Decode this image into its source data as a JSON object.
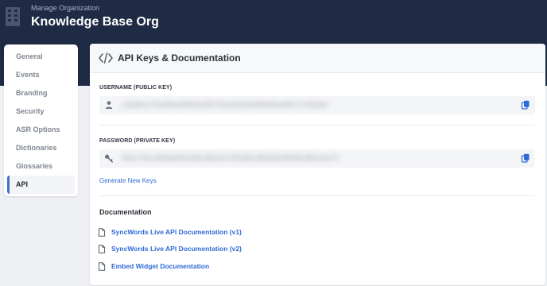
{
  "header": {
    "subtitle": "Manage Organization",
    "title": "Knowledge Base Org"
  },
  "sidebar": {
    "items": [
      {
        "label": "General"
      },
      {
        "label": "Events"
      },
      {
        "label": "Branding"
      },
      {
        "label": "Security"
      },
      {
        "label": "ASR Options"
      },
      {
        "label": "Dictionaries"
      },
      {
        "label": "Glossaries"
      },
      {
        "label": "API",
        "active": true
      }
    ]
  },
  "panel": {
    "title": "API Keys & Documentation",
    "username_label": "USERNAME (PUBLIC KEY)",
    "username_value": "c3a9f1e7b2d84a6f9c0e5b7d1a2f4c8e6b9d0a3f5c7e1b2d4",
    "password_label": "PASSWORD (PRIVATE KEY)",
    "password_value": "9f2e7d1c4b8a6f3e0d5c9b2a7e4f1d8c3b6a0e9f2d5c8b1a4e7f",
    "generate_link": "Generate New Keys",
    "documentation_heading": "Documentation",
    "docs": [
      {
        "label": "SyncWords Live API Documentation (v1)"
      },
      {
        "label": "SyncWords Live API Documentation (v2)"
      },
      {
        "label": "Embed Widget Documentation"
      }
    ]
  },
  "colors": {
    "header_bg": "#1f2a44",
    "link": "#2f6ad6",
    "active_indicator": "#3b6fd6"
  }
}
